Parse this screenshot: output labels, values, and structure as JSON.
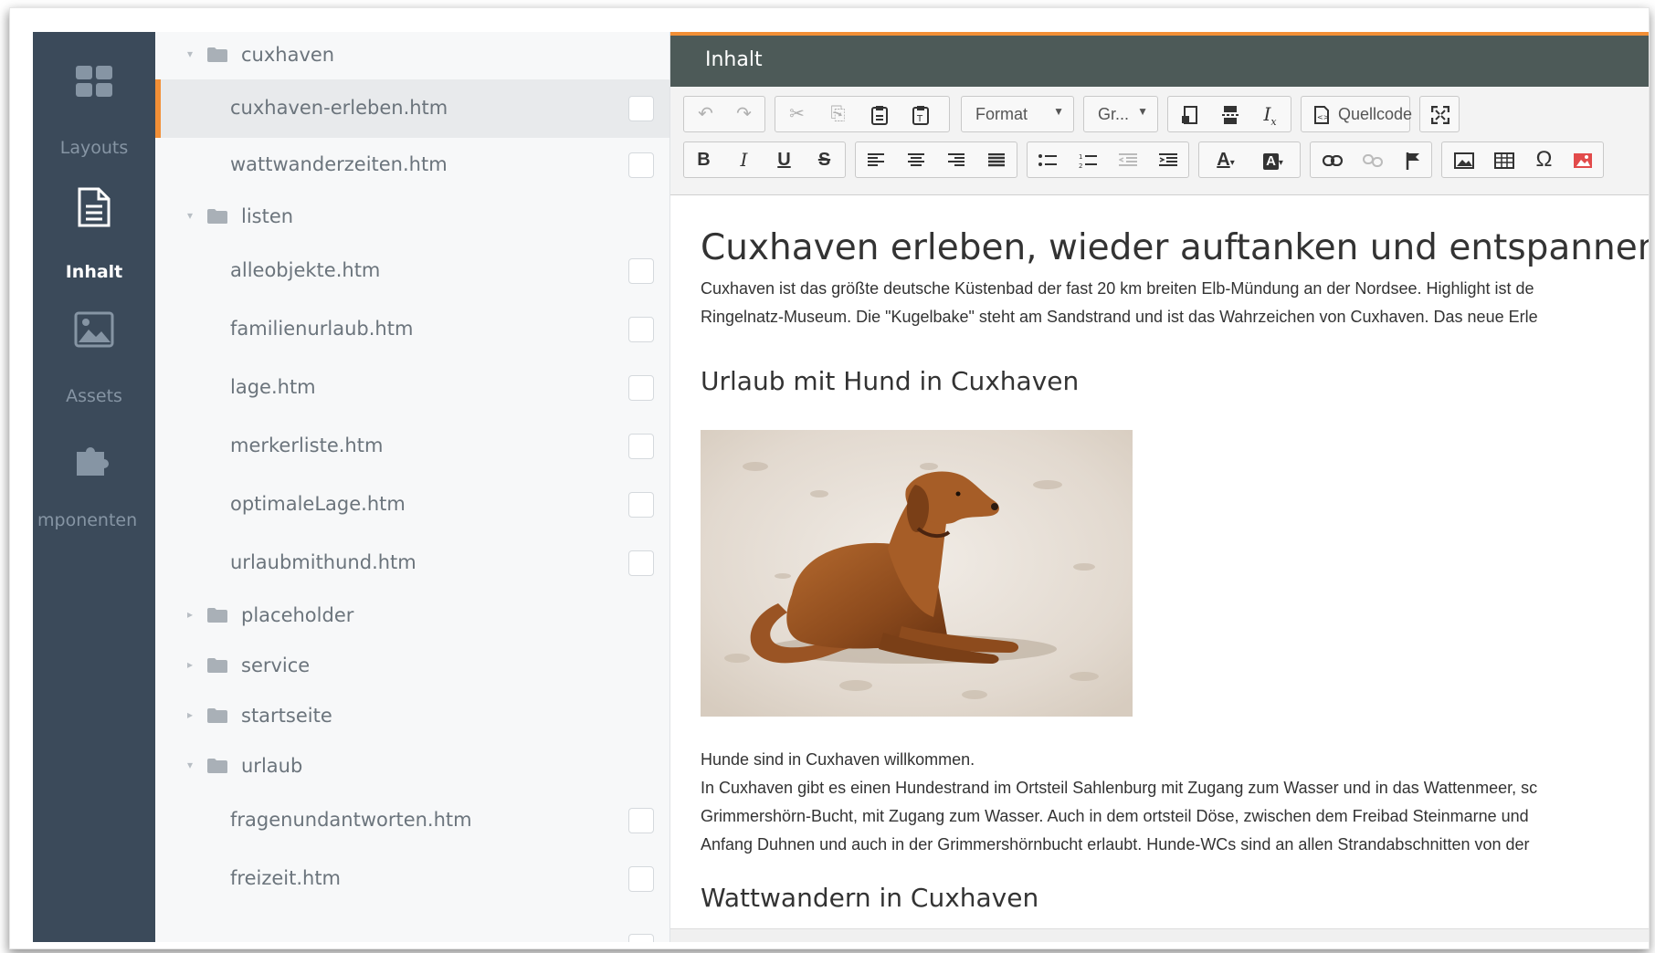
{
  "sidebar": {
    "items": [
      {
        "label": "Layouts",
        "icon": "layouts-icon"
      },
      {
        "label": "Inhalt",
        "icon": "document-icon",
        "active": true
      },
      {
        "label": "Assets",
        "icon": "image-icon"
      },
      {
        "label": "mponenten",
        "icon": "puzzle-icon"
      }
    ]
  },
  "tree": {
    "rows": [
      {
        "type": "folder",
        "name": "cuxhaven",
        "expanded": true
      },
      {
        "type": "file",
        "name": "cuxhaven-erleben.htm",
        "selected": true
      },
      {
        "type": "file",
        "name": "wattwanderzeiten.htm"
      },
      {
        "type": "folder",
        "name": "listen",
        "expanded": true
      },
      {
        "type": "file",
        "name": "alleobjekte.htm"
      },
      {
        "type": "file",
        "name": "familienurlaub.htm"
      },
      {
        "type": "file",
        "name": "lage.htm"
      },
      {
        "type": "file",
        "name": "merkerliste.htm"
      },
      {
        "type": "file",
        "name": "optimaleLage.htm"
      },
      {
        "type": "file",
        "name": "urlaubmithund.htm"
      },
      {
        "type": "folder",
        "name": "placeholder",
        "expanded": false
      },
      {
        "type": "folder",
        "name": "service",
        "expanded": false
      },
      {
        "type": "folder",
        "name": "startseite",
        "expanded": false
      },
      {
        "type": "folder",
        "name": "urlaub",
        "expanded": true
      },
      {
        "type": "file",
        "name": "fragenundantworten.htm"
      },
      {
        "type": "file",
        "name": "freizeit.htm"
      }
    ]
  },
  "editor": {
    "title": "Inhalt",
    "toolbar": {
      "format_label": "Format",
      "size_label": "Gr...",
      "source_label": "Quellcode"
    },
    "document": {
      "heading": "Cuxhaven erleben, wieder auftanken und entspannen",
      "intro_line1": "Cuxhaven ist das größte deutsche Küstenbad der fast 20 km breiten Elb-Mündung an der Nordsee. Highlight ist de",
      "intro_line2": "Ringelnatz-Museum. Die \"Kugelbake\" steht am Sandstrand und ist das Wahrzeichen von Cuxhaven. Das neue Erle",
      "sub_heading1": "Urlaub mit Hund in Cuxhaven",
      "dog_line1": "Hunde sind in Cuxhaven willkommen.",
      "dog_line2": "In Cuxhaven gibt es einen Hundestrand im Ortsteil Sahlenburg mit Zugang zum Wasser und in das Wattenmeer, sc",
      "dog_line3": "Grimmershörn-Bucht, mit Zugang zum Wasser. Auch in dem ortsteil Döse, zwischen dem Freibad Steinmarne und",
      "dog_line4": "Anfang Duhnen und auch in der Grimmershörnbucht erlaubt. Hunde-WCs sind an allen Strandabschnitten von der",
      "sub_heading2": "Wattwandern in Cuxhaven"
    }
  },
  "colors": {
    "sidebar_bg": "#3b4a5a",
    "accent": "#f28f36",
    "editor_header": "#4d5a58"
  }
}
